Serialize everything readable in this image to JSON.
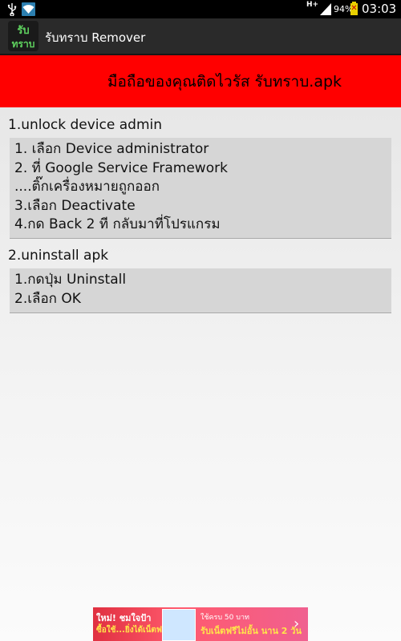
{
  "status_bar": {
    "network": "H+",
    "battery_percent": "94%",
    "time": "03:03"
  },
  "action_bar": {
    "app_icon_text": "รับทราบ",
    "title": "รับทราบ Remover"
  },
  "banner": {
    "text": "มือถือของคุณติดไวรัส รับทราบ.apk"
  },
  "sections": [
    {
      "title": "1.unlock device admin",
      "lines": [
        "1. เลือก Device administrator",
        "2. ที่ Google Service Framework",
        "....ติ๊กเครื่องหมายถูกออก",
        "3.เลือก Deactivate",
        "4.กด Back 2 ที กลับมาที่โปรแกรม"
      ]
    },
    {
      "title": "2.uninstall apk",
      "lines": [
        "1.กดปุ่ม Uninstall",
        "2.เลือก OK"
      ]
    }
  ],
  "ad": {
    "line1": "ใหม่! ชมใจป้า",
    "line2": "ซื้อใช้...ยิ่งได้เน็ตฟรี",
    "line3": "ใช้ครบ 50 บาท",
    "line4": "รับเน็ตฟรีไม่อั้น นาน 2 วัน"
  },
  "colors": {
    "banner": "#ff0000",
    "action_bar": "#2a2a2a",
    "box": "#d6d6d6"
  }
}
